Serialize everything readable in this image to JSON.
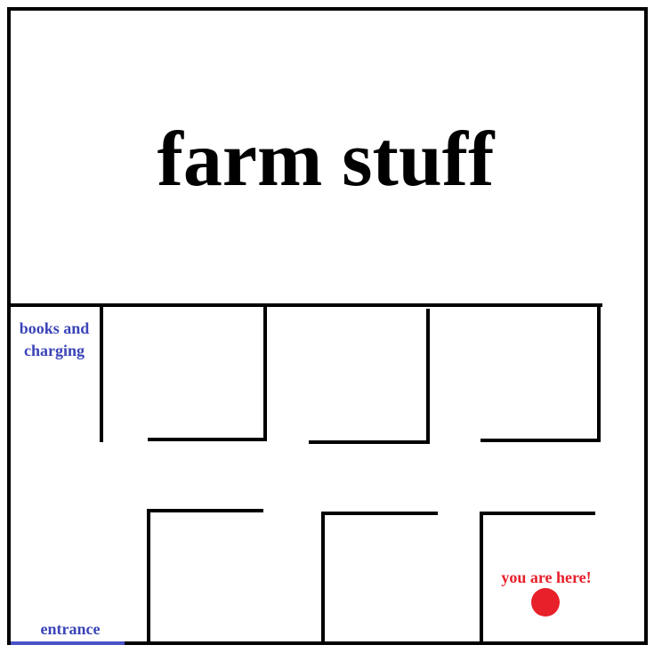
{
  "map": {
    "title": "farm stuff",
    "areas": {
      "books_line1": "books and",
      "books_line2": "charging"
    },
    "entrance_label": "entrance",
    "you_are_here_label": "you are here!",
    "colors": {
      "walls": "#000000",
      "area_label": "#3a44b8",
      "entrance": "#4a52c8",
      "marker": "#e8202a",
      "background": "#ffffff"
    }
  }
}
